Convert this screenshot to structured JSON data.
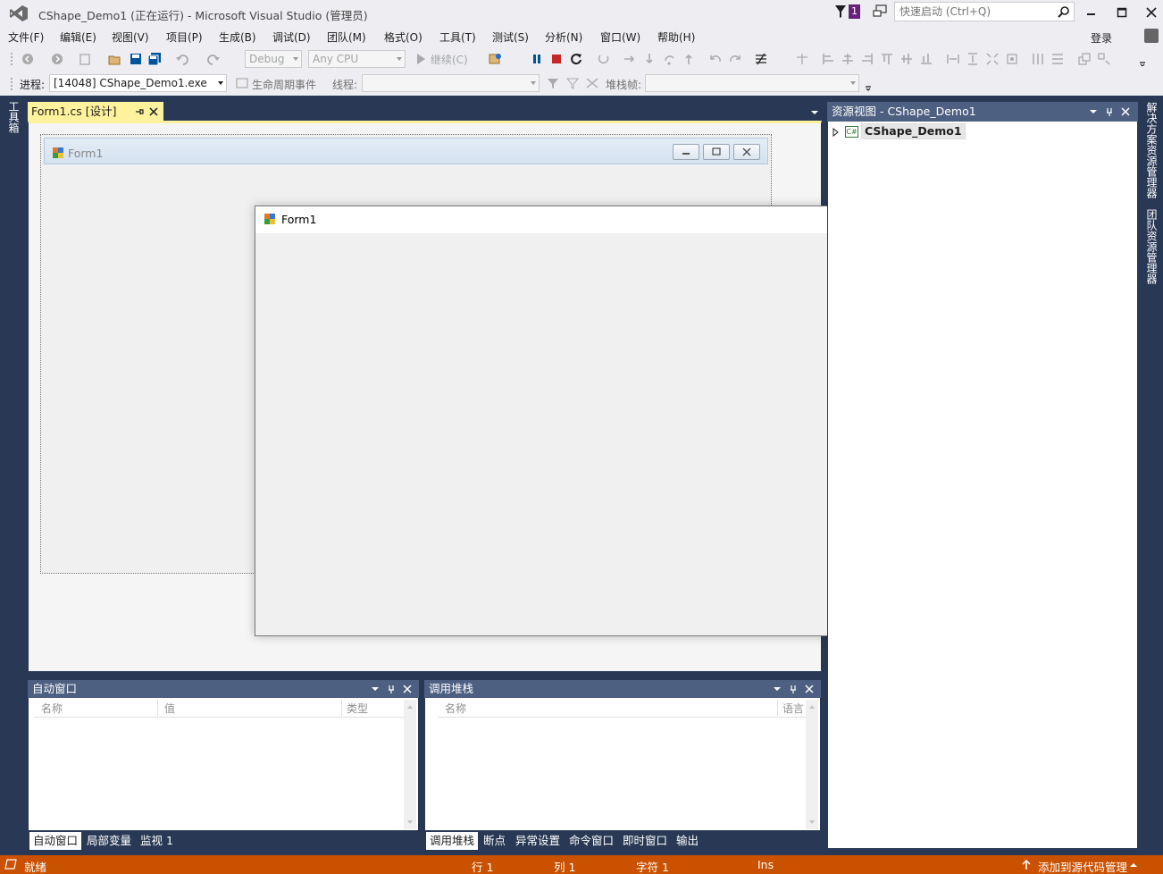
{
  "window": {
    "title": "CShape_Demo1 (正在运行) - Microsoft Visual Studio (管理员)",
    "notification_count": "1"
  },
  "quick_launch": {
    "placeholder": "快速启动 (Ctrl+Q)"
  },
  "menu": [
    "文件(F)",
    "编辑(E)",
    "视图(V)",
    "项目(P)",
    "生成(B)",
    "调试(D)",
    "团队(M)",
    "格式(O)",
    "工具(T)",
    "测试(S)",
    "分析(N)",
    "窗口(W)",
    "帮助(H)"
  ],
  "login": "登录",
  "toolbar1": {
    "config": "Debug",
    "platform": "Any CPU",
    "continue": "继续(C)"
  },
  "toolbar2": {
    "process_label": "进程:",
    "process_value": "[14048] CShape_Demo1.exe",
    "lifecycle": "生命周期事件",
    "thread_label": "线程:",
    "stack_label": "堆栈帧:"
  },
  "left_tabs": {
    "toolbox": "工具箱"
  },
  "editor": {
    "tab_label": "Form1.cs [设计]",
    "designer_form_title": "Form1"
  },
  "running_form": {
    "title": "Form1"
  },
  "resource_view": {
    "header": "资源视图 - CShape_Demo1",
    "root_item": "CShape_Demo1",
    "root_icon_text": "C#"
  },
  "right_tabs": {
    "solution_explorer": "解决方案资源管理器",
    "team_explorer": "团队资源管理器"
  },
  "auto_window": {
    "header": "自动窗口",
    "columns": [
      "名称",
      "值",
      "类型"
    ],
    "tabs": [
      "自动窗口",
      "局部变量",
      "监视 1"
    ]
  },
  "call_stack": {
    "header": "调用堆栈",
    "columns": [
      "名称",
      "语言"
    ],
    "tabs": [
      "调用堆栈",
      "断点",
      "异常设置",
      "命令窗口",
      "即时窗口",
      "输出"
    ]
  },
  "status": {
    "ready": "就绪",
    "line": "行 1",
    "col": "列 1",
    "char": "字符 1",
    "ins": "Ins",
    "source_control": "添加到源代码管理"
  }
}
